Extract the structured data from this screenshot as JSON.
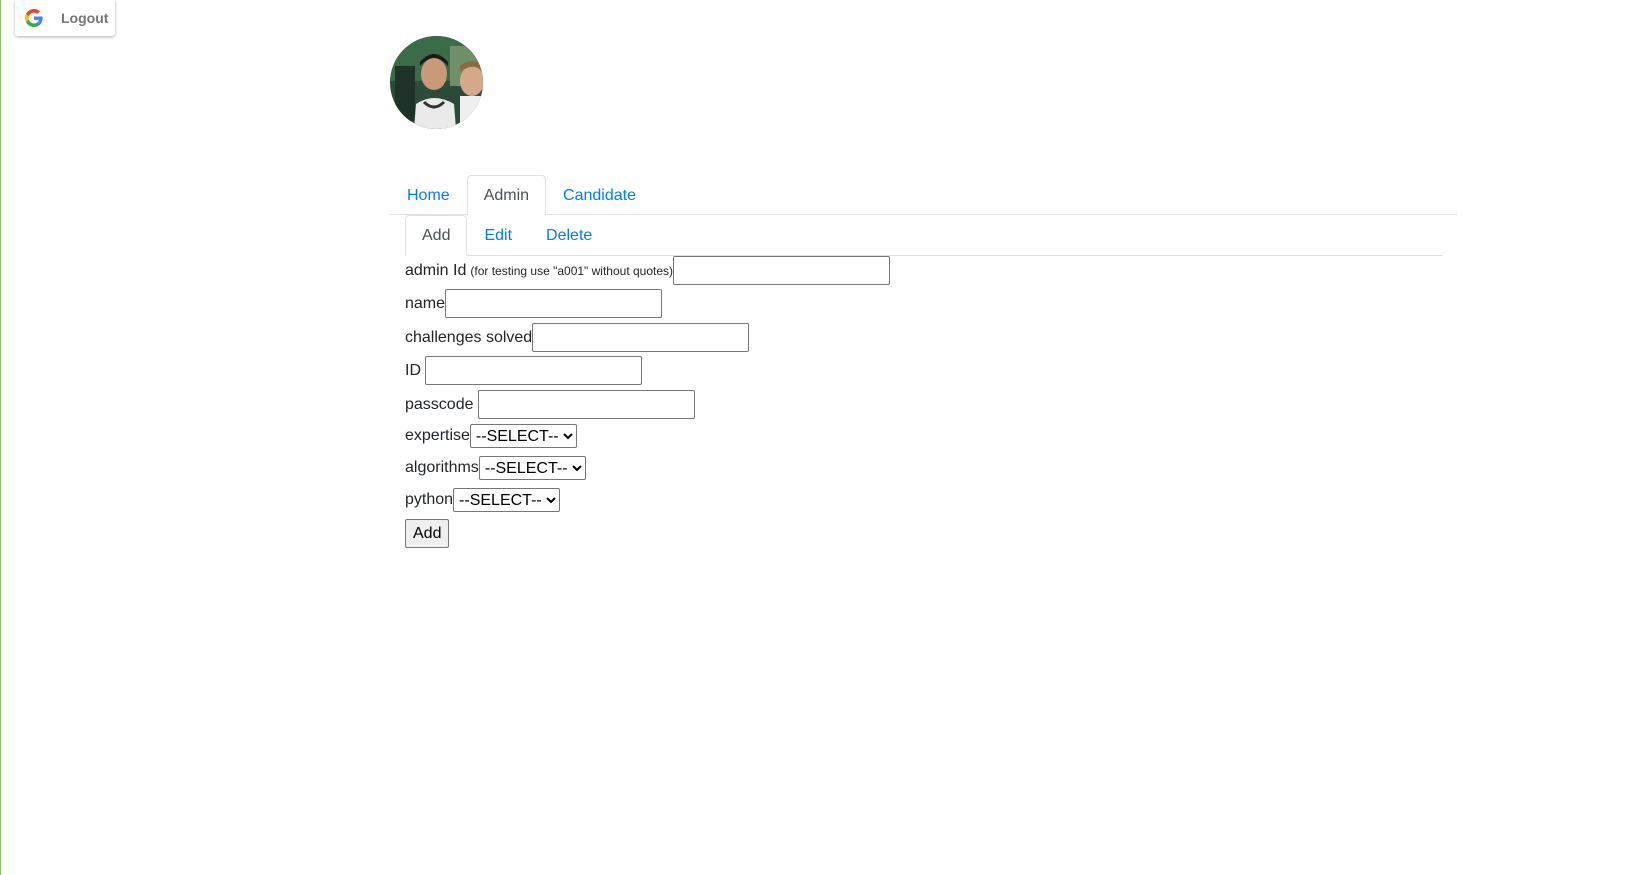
{
  "header": {
    "logout_label": "Logout"
  },
  "nav": {
    "tabs": [
      {
        "label": "Home"
      },
      {
        "label": "Admin"
      },
      {
        "label": "Candidate"
      }
    ],
    "active_tab": "Admin"
  },
  "subnav": {
    "tabs": [
      {
        "label": "Add"
      },
      {
        "label": "Edit"
      },
      {
        "label": "Delete"
      }
    ],
    "active_tab": "Add"
  },
  "form": {
    "admin_id_label": "admin Id",
    "admin_id_hint": "(for testing use \"a001\" without quotes)",
    "admin_id_value": "",
    "name_label": "name",
    "name_value": "",
    "challenges_label": "challenges solved",
    "challenges_value": "",
    "id_label": "ID",
    "id_value": "",
    "passcode_label": "passcode",
    "passcode_value": "",
    "expertise_label": "expertise",
    "expertise_selected": "--SELECT--",
    "algorithms_label": "algorithms",
    "algorithms_selected": "--SELECT--",
    "python_label": "python",
    "python_selected": "--SELECT--",
    "submit_label": "Add"
  },
  "colors": {
    "link": "#007bff",
    "active_tab_text": "#495057",
    "border": "#dee2e6"
  }
}
